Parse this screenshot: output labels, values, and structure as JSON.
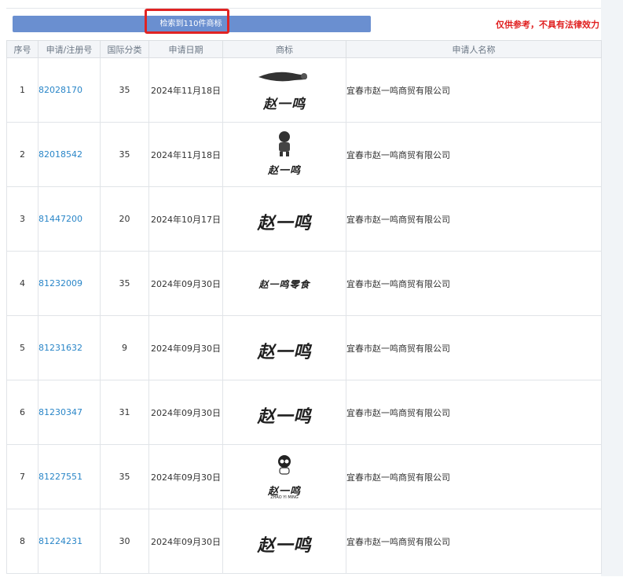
{
  "header": {
    "count_label": "检索到110件商标",
    "disclaimer": "仅供参考，不具有法律效力"
  },
  "table": {
    "columns": [
      "序号",
      "申请/注册号",
      "国际分类",
      "申请日期",
      "商标",
      "申请人名称"
    ],
    "rows": [
      {
        "index": "1",
        "reg_no": "82028170",
        "class": "35",
        "date": "2024年11月18日",
        "logo": "赵一鸣",
        "applicant": "宜春市赵一鸣商贸有限公司"
      },
      {
        "index": "2",
        "reg_no": "82018542",
        "class": "35",
        "date": "2024年11月18日",
        "logo": "赵一鸣",
        "applicant": "宜春市赵一鸣商贸有限公司"
      },
      {
        "index": "3",
        "reg_no": "81447200",
        "class": "20",
        "date": "2024年10月17日",
        "logo": "赵一鸣",
        "applicant": "宜春市赵一鸣商贸有限公司"
      },
      {
        "index": "4",
        "reg_no": "81232009",
        "class": "35",
        "date": "2024年09月30日",
        "logo": "赵一鸣零食",
        "applicant": "宜春市赵一鸣商贸有限公司"
      },
      {
        "index": "5",
        "reg_no": "81231632",
        "class": "9",
        "date": "2024年09月30日",
        "logo": "赵一鸣",
        "applicant": "宜春市赵一鸣商贸有限公司"
      },
      {
        "index": "6",
        "reg_no": "81230347",
        "class": "31",
        "date": "2024年09月30日",
        "logo": "赵一鸣",
        "applicant": "宜春市赵一鸣商贸有限公司"
      },
      {
        "index": "7",
        "reg_no": "81227551",
        "class": "35",
        "date": "2024年09月30日",
        "logo": "赵一鸣",
        "logo_sub": "ZHAO YI MING",
        "applicant": "宜春市赵一鸣商贸有限公司"
      },
      {
        "index": "8",
        "reg_no": "81224231",
        "class": "30",
        "date": "2024年09月30日",
        "logo": "赵一鸣",
        "applicant": "宜春市赵一鸣商贸有限公司"
      }
    ]
  },
  "colors": {
    "accent_bar": "#6a8fd0",
    "highlight": "#e02323",
    "link": "#2a86c8",
    "disclaimer": "#e02020"
  }
}
